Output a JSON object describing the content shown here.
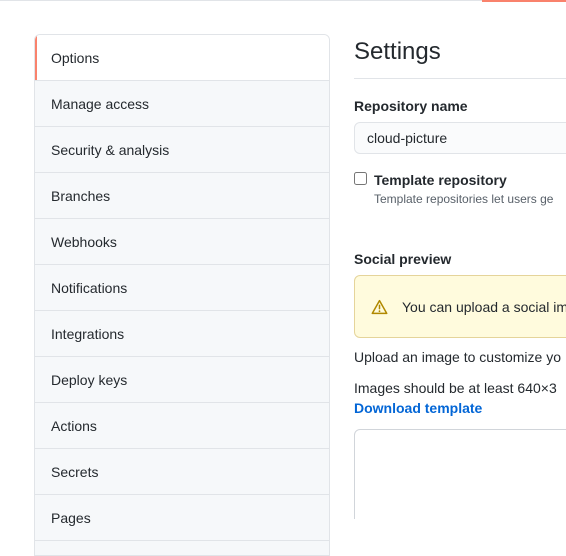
{
  "sidebar": {
    "items": [
      {
        "label": "Options",
        "selected": true
      },
      {
        "label": "Manage access"
      },
      {
        "label": "Security & analysis"
      },
      {
        "label": "Branches"
      },
      {
        "label": "Webhooks"
      },
      {
        "label": "Notifications"
      },
      {
        "label": "Integrations"
      },
      {
        "label": "Deploy keys"
      },
      {
        "label": "Actions"
      },
      {
        "label": "Secrets"
      },
      {
        "label": "Pages"
      }
    ]
  },
  "main": {
    "title": "Settings",
    "repo_name_label": "Repository name",
    "repo_name_value": "cloud-picture",
    "template": {
      "checked": false,
      "label": "Template repository",
      "note": "Template repositories let users ge"
    },
    "social_preview": {
      "heading": "Social preview",
      "flash_icon": "alert-icon",
      "flash_text": "You can upload a social im",
      "upload_text": "Upload an image to customize yo",
      "size_text": "Images should be at least 640×3",
      "download_link": "Download template"
    }
  },
  "colors": {
    "accent": "#f9826c",
    "link": "#0366d6",
    "flash_bg": "#fffbdd",
    "flash_icon": "#b08800"
  }
}
